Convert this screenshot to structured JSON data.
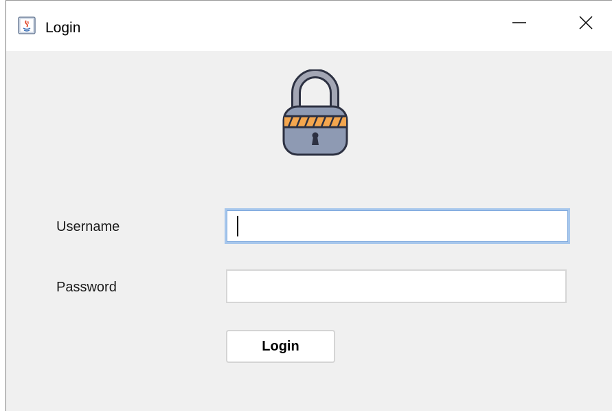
{
  "window": {
    "title": "Login",
    "app_icon": "java-coffee-icon",
    "controls": {
      "minimize_icon": "minimize-icon",
      "close_icon": "close-icon"
    }
  },
  "form": {
    "lock_icon": "padlock-icon",
    "username": {
      "label": "Username",
      "value": ""
    },
    "password": {
      "label": "Password",
      "value": ""
    },
    "login_button_label": "Login"
  },
  "colors": {
    "window_bg": "#f0f0f0",
    "titlebar_bg": "#ffffff",
    "focus_border": "#a7c7ec",
    "lock_body": "#8e9ab3",
    "lock_stripe": "#f4a64e",
    "lock_outline": "#2d3142"
  }
}
